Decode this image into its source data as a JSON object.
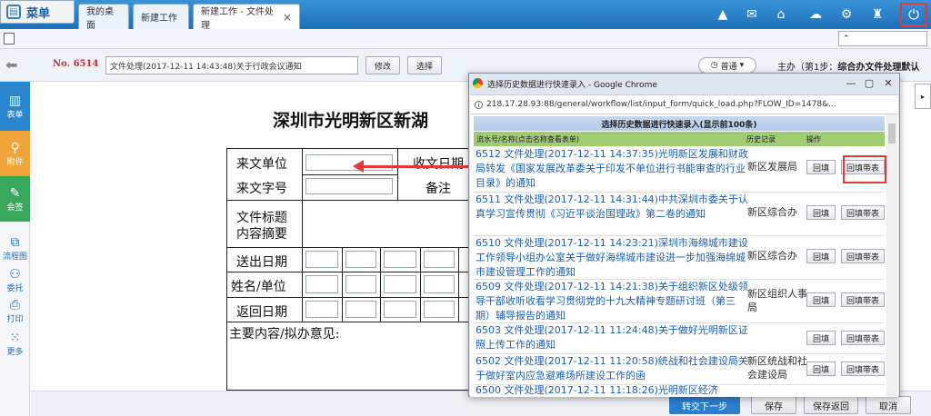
{
  "topbar": {
    "menu_label": "菜单",
    "tabs": [
      {
        "label": "我的桌面"
      },
      {
        "label": "新建工作"
      },
      {
        "label": "新建工作 - 文件处理",
        "close": "×"
      }
    ]
  },
  "toolbar": {
    "flow_no": "No. 6514",
    "title_value": "文件处理(2017-12-11 14:43:48)关于行政会议通知",
    "edit_label": "修改",
    "select_label": "选择",
    "priority": "普通",
    "sponsor_prefix": "主办（第1步：",
    "sponsor_step": "综合办文件处理默认"
  },
  "sidebar": {
    "items": [
      {
        "label": "表单",
        "icon": "form-icon"
      },
      {
        "label": "附件",
        "icon": "attachment-icon"
      },
      {
        "label": "会签",
        "icon": "countersign-icon"
      },
      {
        "label": "流程图",
        "icon": "flowchart-icon"
      },
      {
        "label": "委托",
        "icon": "delegate-icon"
      },
      {
        "label": "打印",
        "icon": "print-icon"
      },
      {
        "label": "更多",
        "icon": "more-icon"
      }
    ]
  },
  "form": {
    "title": "深圳市光明新区新湖",
    "labels": {
      "source_unit": "来文单位",
      "receive_date": "收文日期",
      "doc_number": "来文字号",
      "note": "备注",
      "title_summary_1": "文件标题",
      "title_summary_2": "内容摘要",
      "send_date": "送出日期",
      "name_unit": "姓名/单位",
      "return_date": "返回日期",
      "main_content": "主要内容/拟办意见:"
    }
  },
  "bottom": {
    "next_label": "转交下一步",
    "save_label": "保存",
    "save_return_label": "保存返回",
    "cancel_label": "取消"
  },
  "popup": {
    "window_title": "选择历史数据进行快速录入 - Google Chrome",
    "url": "218.17.28.93:88/general/workflow/list/input_form/quick_load.php?FLOW_ID=1478&...",
    "heading": "选择历史数据进行快速录入(显示前100条)",
    "columns": {
      "flow": "流水号/名称(点击名称查看表单)",
      "history": "历史记录",
      "action": "操作"
    },
    "fill_label": "回填",
    "fill_attach_label": "回填带表",
    "records": [
      {
        "text": "6512 文件处理(2017-12-11 14:37:35)光明新区发展和财政局转发《国家发展改革委关于印发不单位进行书能审查的行业目录》的通知",
        "source": "新区发展局"
      },
      {
        "text": "6511 文件处理(2017-12-11 14:31:44)中共深圳市委关于认真学习宣传贯彻《习近平谈治国理政》第二卷的通知",
        "source": "新区综合办"
      },
      {
        "text": "6510 文件处理(2017-12-11 14:23:21)深圳市海绵城市建设工作领导小组办公室关于做好海绵城市建设进一步加强海绵城市建设管理工作的通知",
        "source": "新区综合办"
      },
      {
        "text": "6509 文件处理(2017-12-11 14:21:38)关于组织新区处级领导干部收听收看学习贯彻党的十九大精神专题研讨班（第三期）辅导报告的通知",
        "source": "新区组织人事局"
      },
      {
        "text": "6503 文件处理(2017-12-11 11:24:48)关于做好光明新区证照上传工作的通知",
        "source": ""
      },
      {
        "text": "6502 文件处理(2017-12-11 11:20:58)统战和社会建设局关于做好室内应急避难场所建设工作的函",
        "source": "新区统战和社会建设局"
      },
      {
        "text": "6500 文件处理(2017-12-11 11:18:26)光明新区经济",
        "source": ""
      }
    ]
  }
}
